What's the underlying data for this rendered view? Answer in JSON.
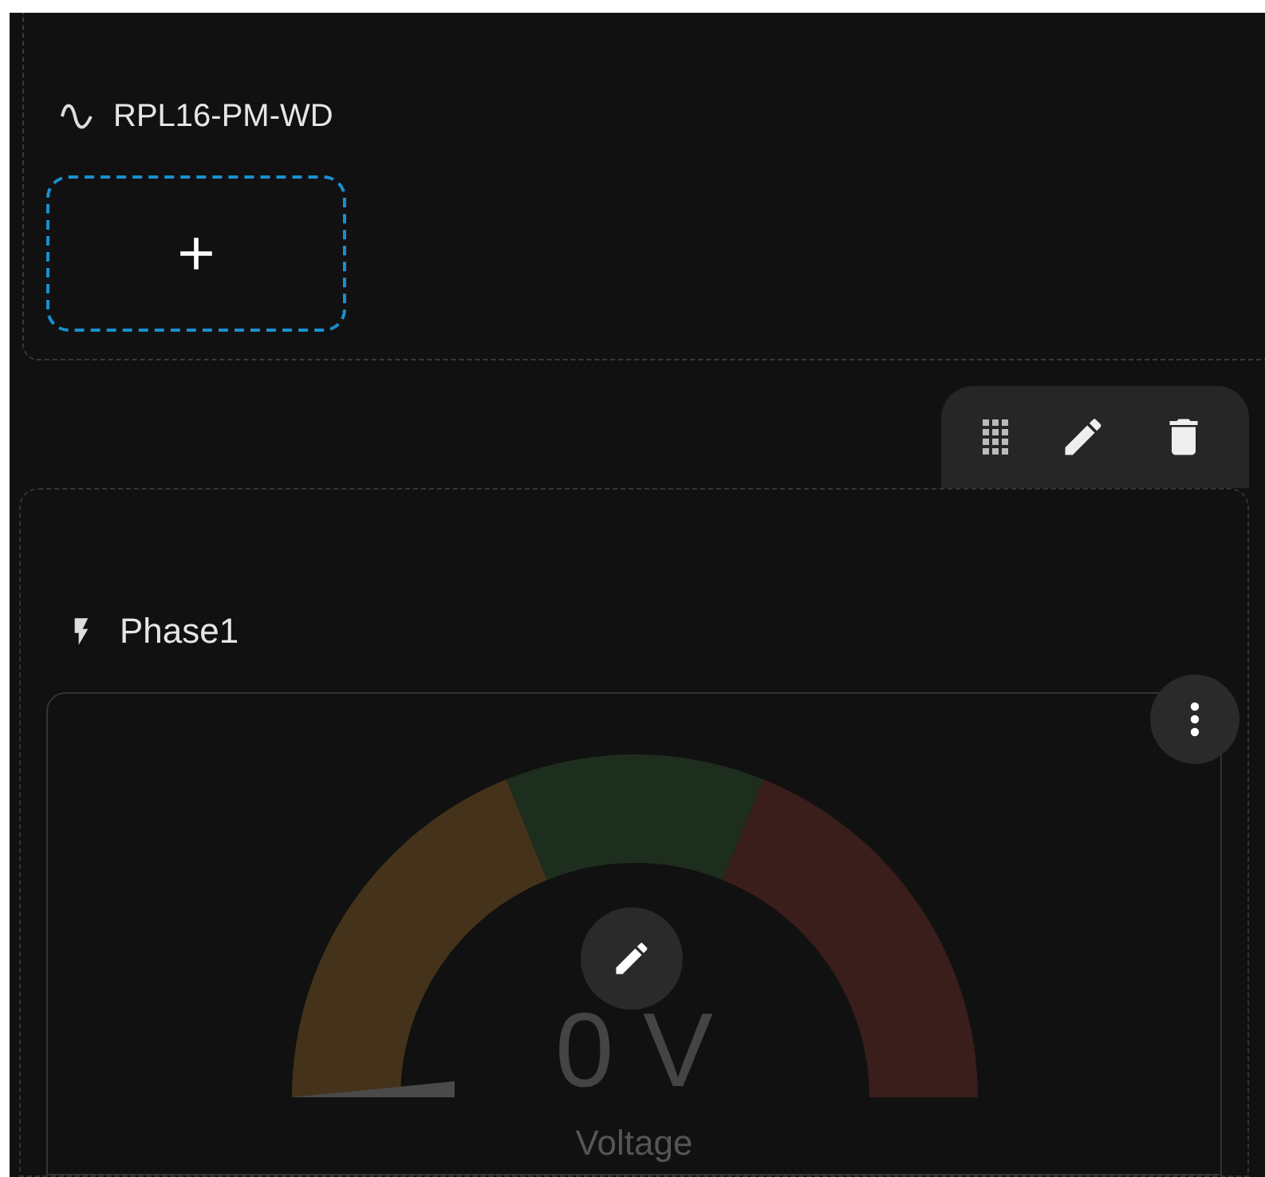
{
  "device": {
    "title": "RPL16-PM-WD"
  },
  "phase": {
    "title": "Phase1",
    "gauge": {
      "reading": "0 V",
      "label": "Voltage",
      "segments": [
        {
          "color": "#44331a"
        },
        {
          "color": "#1e2e1e"
        },
        {
          "color": "#3a1e1b"
        }
      ]
    }
  }
}
